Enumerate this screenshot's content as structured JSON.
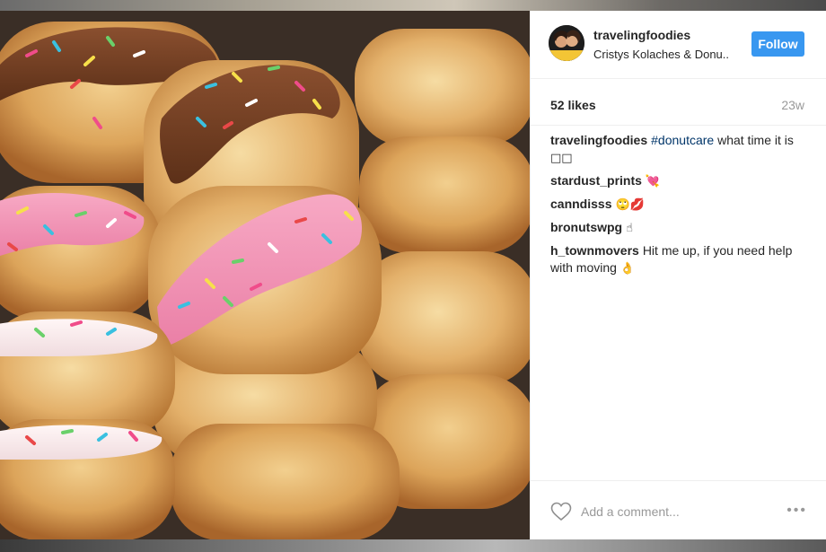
{
  "post": {
    "username": "travelingfoodies",
    "location": "Cristys Kolaches & Donu..",
    "follow_label": "Follow",
    "likes": "52 likes",
    "age": "23w"
  },
  "caption": {
    "user": "travelingfoodies",
    "hashtag": "#donutcare",
    "text": "what time it is",
    "emoji": "□□"
  },
  "comments": [
    {
      "user": "stardust_prints",
      "text": "",
      "emoji": "💘"
    },
    {
      "user": "canndisss",
      "text": "",
      "emoji": "🙄💋"
    },
    {
      "user": "bronutswpg",
      "text": "",
      "emoji": "☝"
    },
    {
      "user": "h_townmovers",
      "text": "Hit me up, if you need help with moving",
      "emoji": "👌"
    }
  ],
  "footer": {
    "add_comment_placeholder": "Add a comment...",
    "more_label": "•••"
  },
  "colors": {
    "follow_button": "#3897f0",
    "hashtag": "#003569",
    "muted_text": "#999999"
  }
}
